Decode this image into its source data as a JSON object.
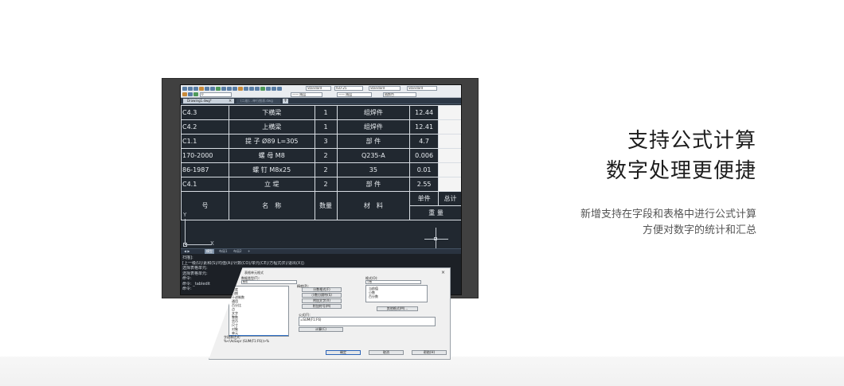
{
  "headline": {
    "line1": "支持公式计算",
    "line2": "数字处理更便捷"
  },
  "description": {
    "line1": "新增支持在字段和表格中进行公式计算",
    "line2": "方便对数字的统计和汇总"
  },
  "colors": {
    "background": "#ffffff",
    "canvas": "#212830",
    "bezel": "#404040",
    "headline_text": "#1d1d1d",
    "description_text": "#555555",
    "dialog_selection": "#2f6fc7"
  },
  "cad": {
    "toolbar": {
      "style_combo": "Standard",
      "dim_combo": "ISO-25",
      "table_combo": "Standard",
      "multileader_combo": "Standard",
      "layer_combo": "0",
      "linetype_combo": "—— 随层",
      "lineweight_combo": "—— 随层",
      "plot_combo": "随颜色"
    },
    "tabs": {
      "active": "Drawing1.dwg*",
      "inactive": "(二维)…单行图表.dwg",
      "add": "+"
    },
    "table": {
      "rows": [
        {
          "code": "C4.3",
          "name": "下横梁",
          "qty": "1",
          "material": "组焊件",
          "weight": "12.44",
          "total": ""
        },
        {
          "code": "C4.2",
          "name": "上横梁",
          "qty": "1",
          "material": "组焊件",
          "weight": "12.41",
          "total": ""
        },
        {
          "code": "C1.1",
          "name": "提 子 Ø89 L=305",
          "qty": "3",
          "material": "部 件",
          "weight": "4.7",
          "total": ""
        },
        {
          "code": "170-2000",
          "name": "螺 母 M8",
          "qty": "2",
          "material": "Q235-A",
          "weight": "0.006",
          "total": ""
        },
        {
          "code": "86-1987",
          "name": "螺 钉 M8x25",
          "qty": "2",
          "material": "35",
          "weight": "0.01",
          "total": ""
        },
        {
          "code": "C4.1",
          "name": "立 堤",
          "qty": "2",
          "material": "部 件",
          "weight": "2.55",
          "total": ""
        }
      ],
      "header": {
        "code": "号",
        "name": "名　称",
        "qty": "数量",
        "material": "材　料",
        "unit": "单件",
        "total": "总计",
        "weight": "重 量"
      }
    },
    "ucs": {
      "x": "X",
      "y": "Y"
    },
    "layout_tabs": [
      "模型",
      "布局1",
      "布局2",
      "+"
    ],
    "command_lines": [
      "扫描]:",
      "[上一级(U)/素和(S)/均值(A)/计数(CO)/单元(CE)/方程式(E)/退出(X)]:",
      "选择表格单元:",
      "选择表格单元:",
      "命令:",
      "命令: _tabledit",
      "",
      "命令:"
    ]
  },
  "dialog": {
    "title": "表格单元格式",
    "close": "×",
    "category_label": "数据类型(T):",
    "category_value": "数值",
    "format_label": "格式(O):",
    "format_value": "小数",
    "list_items": [
      "角度",
      "日期",
      "十进制数",
      "通用",
      "百分比",
      "点",
      "文字",
      "整数",
      "货币",
      "尺寸",
      "对象",
      "单元",
      "公式",
      "字段",
      "块",
      "分数"
    ],
    "selected_index": 12,
    "precision_label": "精度(P):",
    "buttons_mid": [
      "分数格式(F)",
      "小数分隔符(S)",
      "附加文字(X)",
      "附加符号(M)"
    ],
    "right_list_items": [
      "当前值",
      "小数",
      "百分数"
    ],
    "extra_format_button": "其他格式(M)…",
    "formula_label": "公式(F):",
    "formula_value": "=SUM(F1:F6)",
    "recalc_button": "计算(C)",
    "field_expression_label": "字段表达式:",
    "field_expression_value": "%<\\AcExpr (SUM(F1:F6))>%",
    "ok": "确定",
    "cancel": "取消",
    "help": "帮助(H)"
  }
}
